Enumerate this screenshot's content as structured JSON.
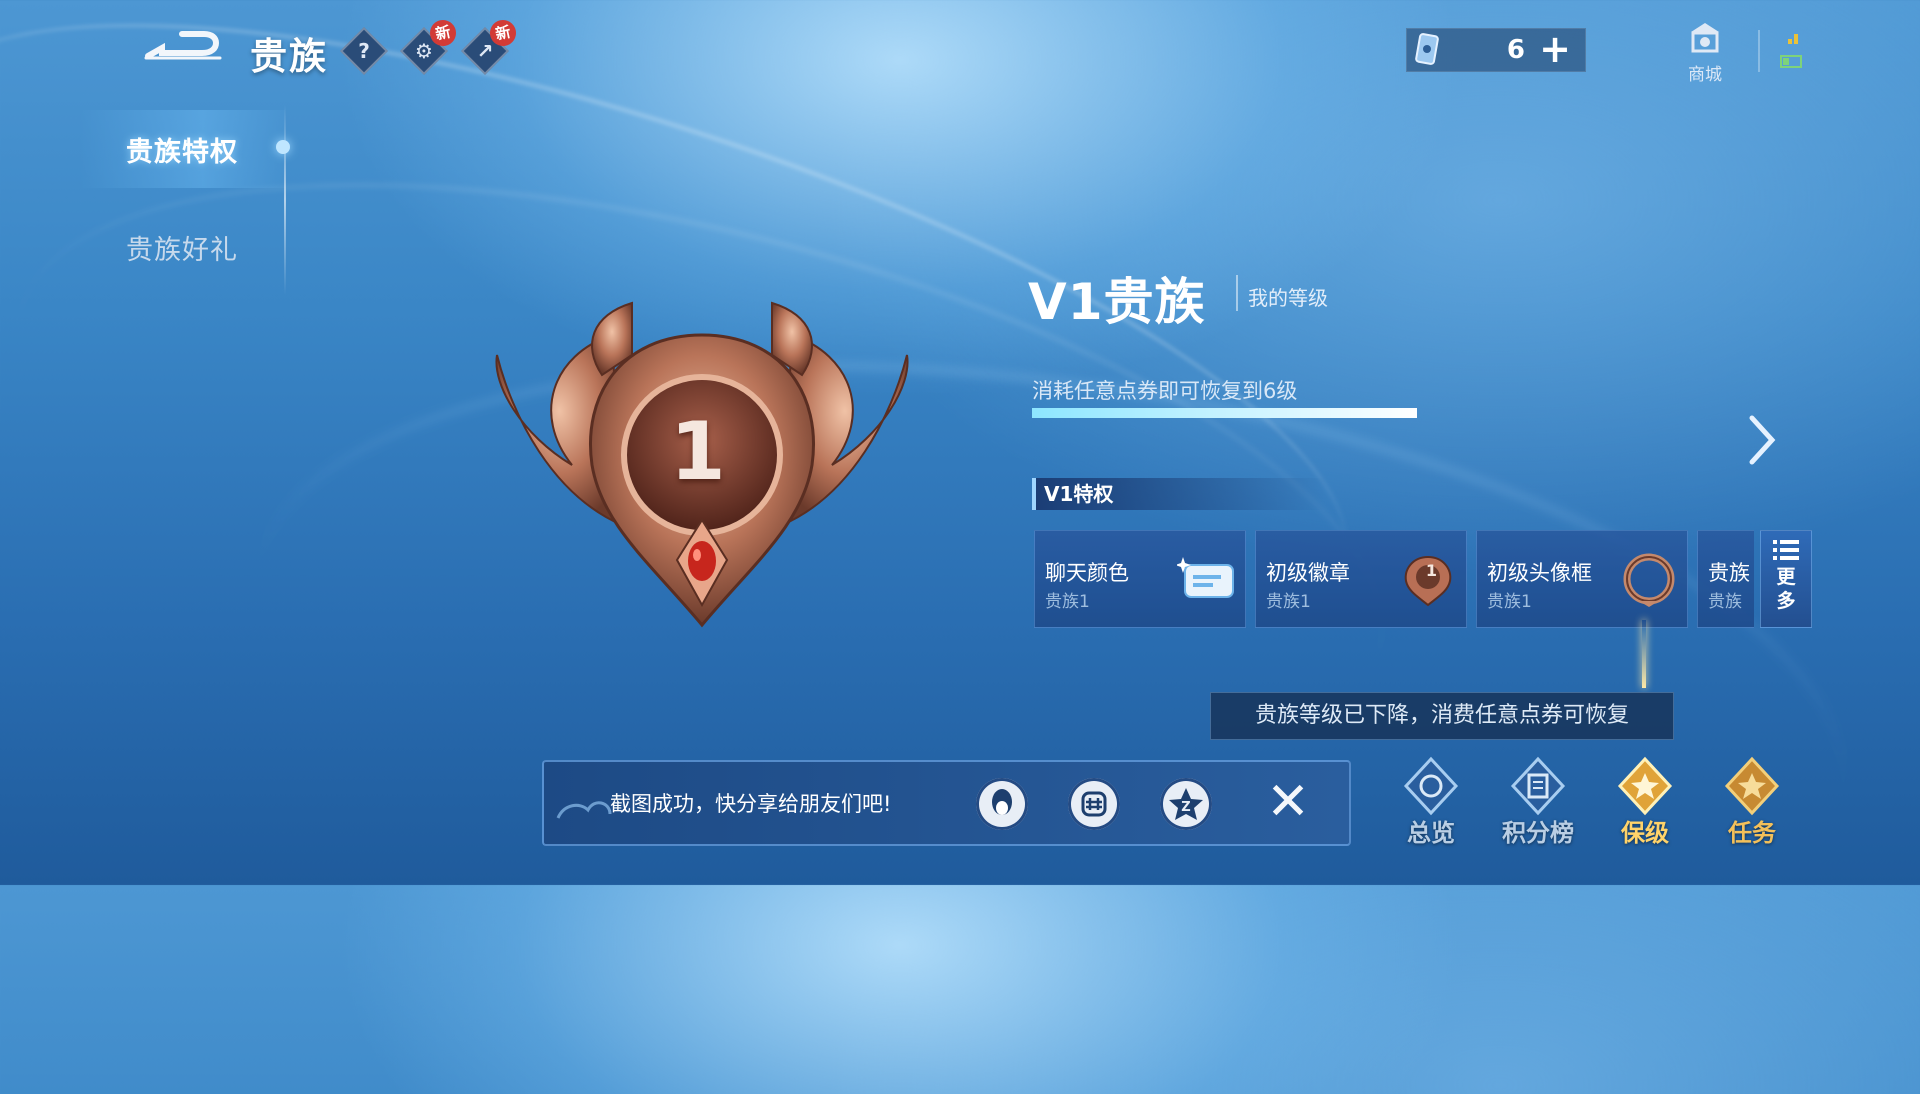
{
  "header": {
    "title": "贵族",
    "help_symbol": "?",
    "new_badge": "新"
  },
  "currency": {
    "ticket_count": "6",
    "add_symbol": "+"
  },
  "shop": {
    "label": "商城"
  },
  "sidebar": {
    "items": [
      {
        "label": "贵族特权",
        "active": true
      },
      {
        "label": "贵族好礼",
        "active": false
      }
    ]
  },
  "level": {
    "title": "V1贵族",
    "subtitle": "我的等级",
    "emblem_number": "1",
    "restore_text": "消耗任意点券即可恢复到6级",
    "progress": 1.0
  },
  "privileges": {
    "header": "V1特权",
    "items": [
      {
        "name": "聊天颜色",
        "sub": "贵族1"
      },
      {
        "name": "初级徽章",
        "sub": "贵族1"
      },
      {
        "name": "初级头像框",
        "sub": "贵族1"
      },
      {
        "name": "贵族",
        "sub": "贵族"
      }
    ],
    "more_label_1": "更",
    "more_label_2": "多",
    "badge_number": "1"
  },
  "notice": {
    "downgrade": "贵族等级已下降，消费任意点券可恢复"
  },
  "bottom_nav": [
    {
      "label": "总览"
    },
    {
      "label": "积分榜"
    },
    {
      "label": "保级"
    },
    {
      "label": "任务"
    }
  ],
  "toast": {
    "text": "截图成功，快分享给朋友们吧!",
    "close_symbol": "✕"
  },
  "colors": {
    "accent": "#9fd6ff",
    "gold": "#f3c05a",
    "bronze": "#b86f55",
    "background": "#3a86c6"
  }
}
